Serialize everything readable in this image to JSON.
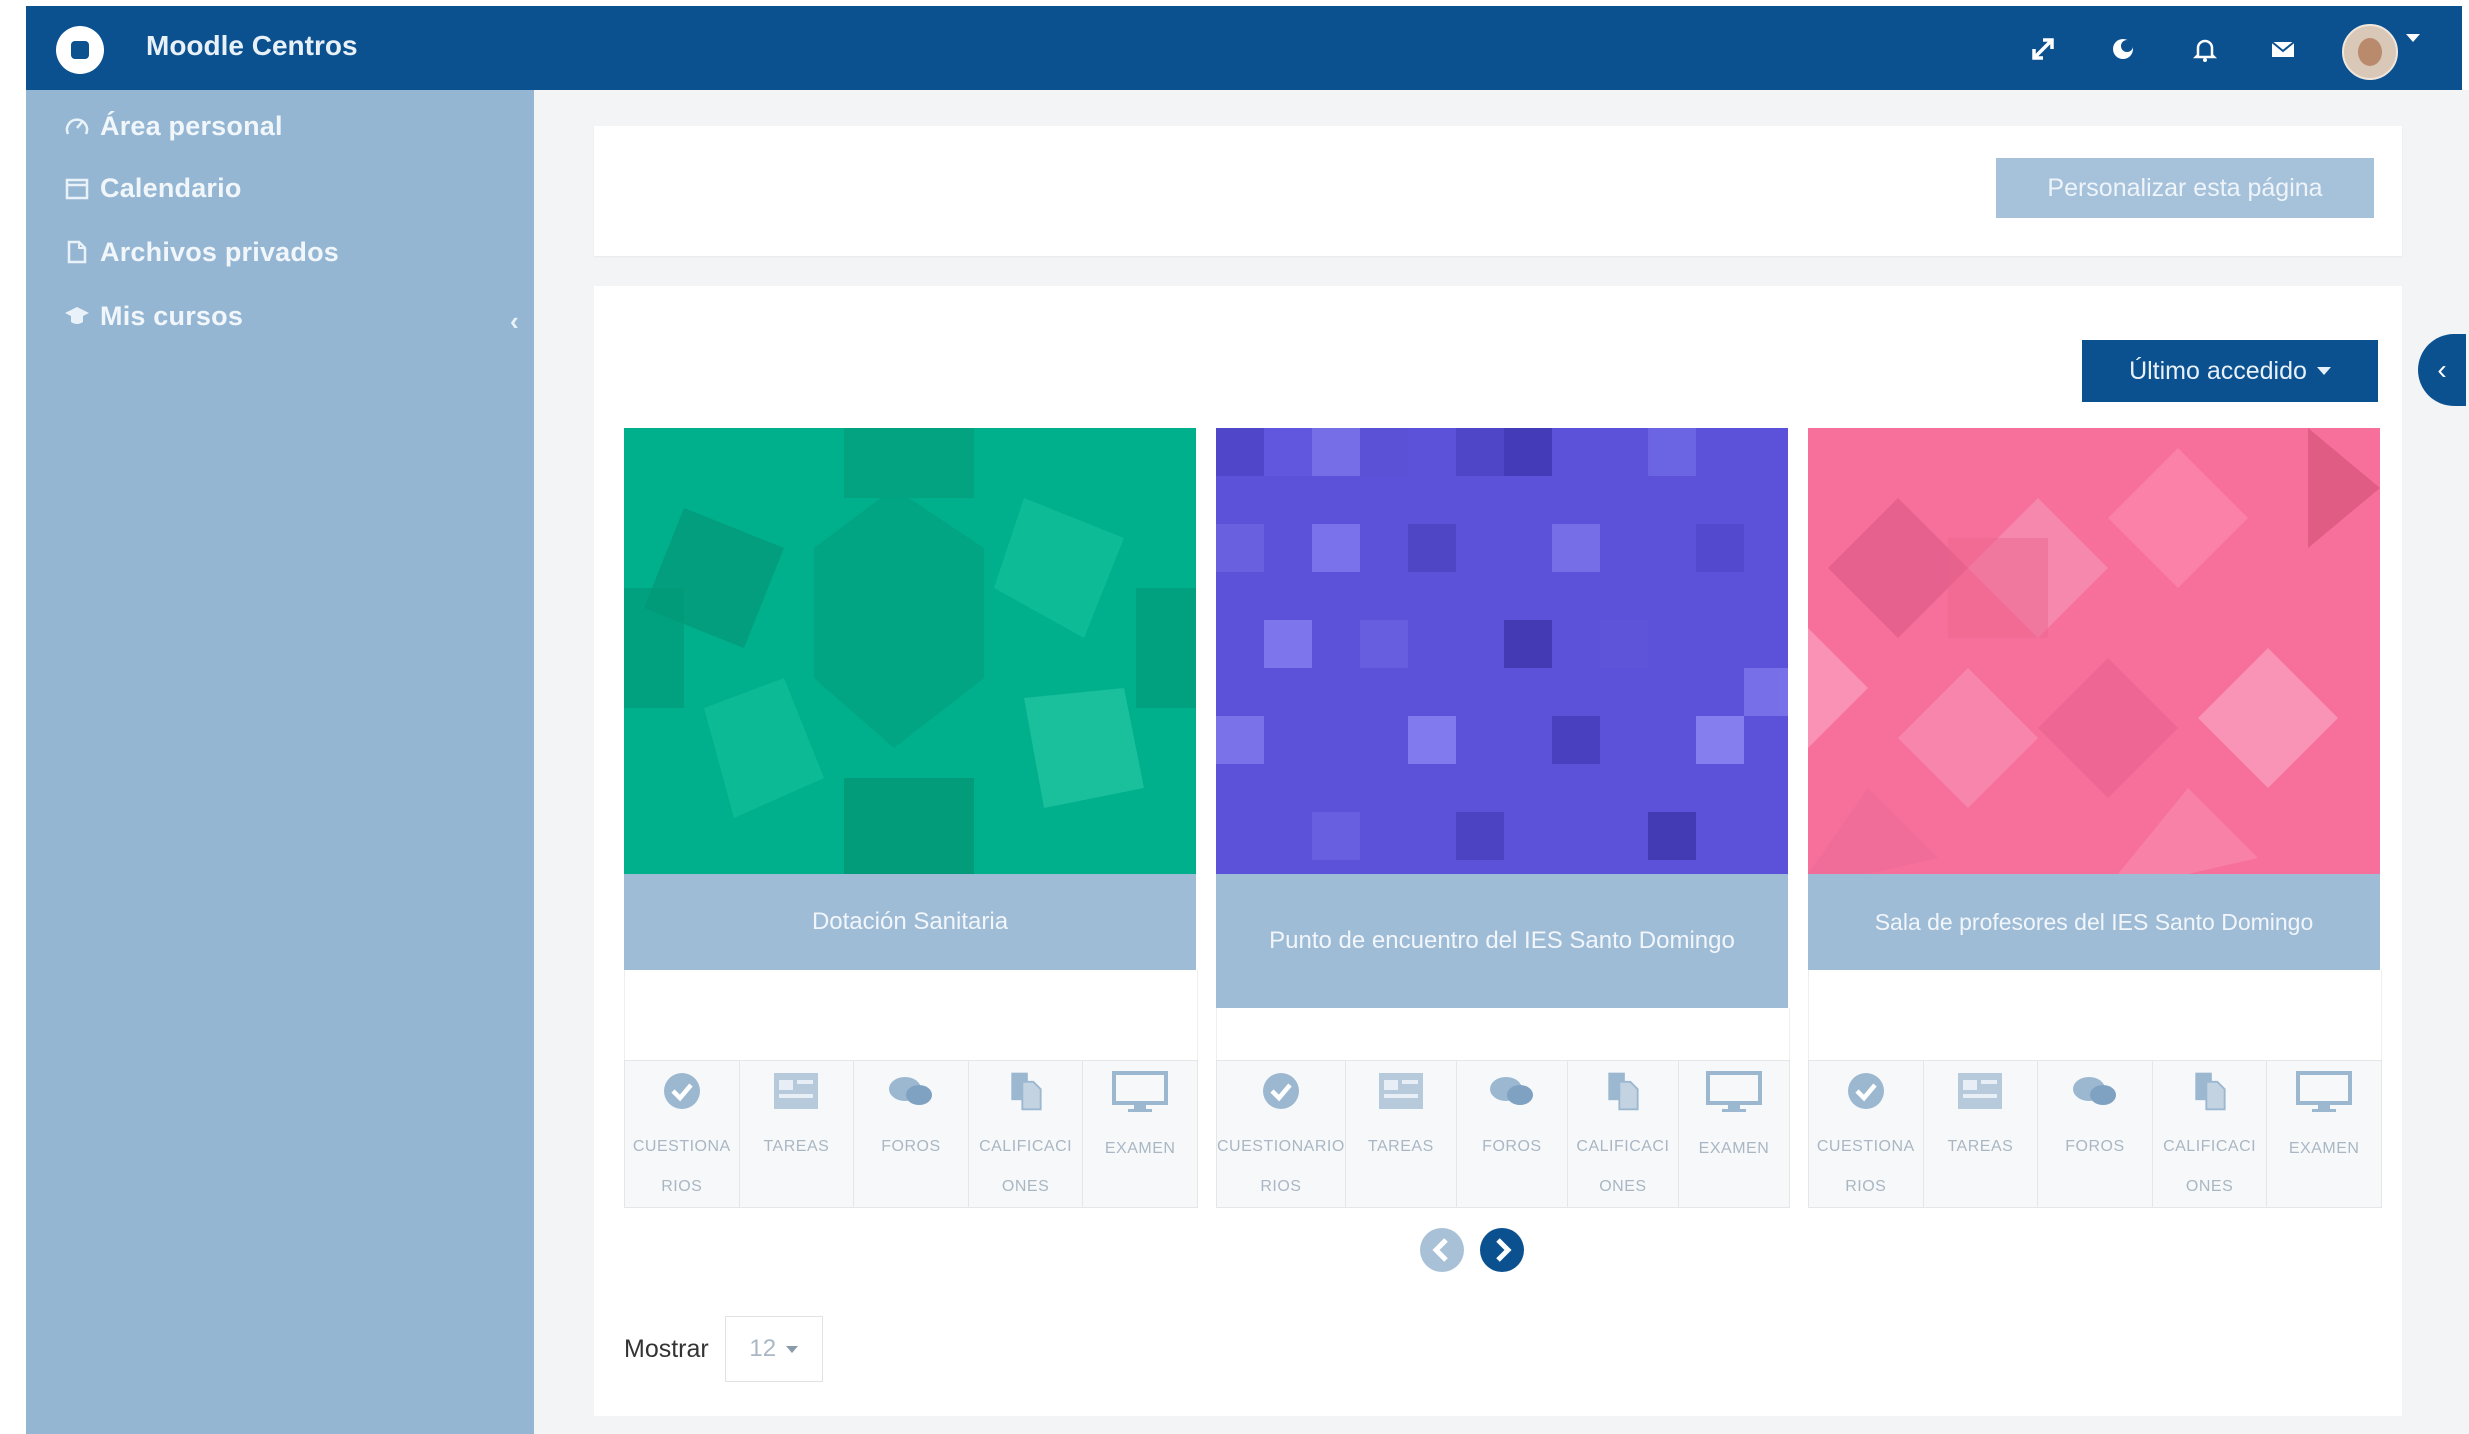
{
  "header": {
    "brand": "Moodle Centros",
    "icons": [
      "expand-icon",
      "theme-icon",
      "bell-icon",
      "envelope-icon",
      "avatar"
    ],
    "colors": {
      "bar": "#0b5190"
    }
  },
  "sidebar": {
    "items": [
      {
        "label": "Área personal",
        "icon": "dashboard-icon"
      },
      {
        "label": "Calendario",
        "icon": "calendar-icon"
      },
      {
        "label": "Archivos privados",
        "icon": "files-icon"
      },
      {
        "label": "Mis cursos",
        "icon": "graduation-cap-icon",
        "expandable": true
      }
    ],
    "colors": {
      "background": "#94b6d3"
    }
  },
  "main": {
    "customize_label": "Personalizar esta página",
    "sort_label": "Último accedido",
    "collapse_glyph": "‹",
    "courses": [
      {
        "title": "Dotación Sanitaria",
        "color": "#00b08c",
        "activities": [
          {
            "icon": "check-icon",
            "caption": "CUESTIONA|RIOS"
          },
          {
            "icon": "table-icon",
            "caption": "TAREAS"
          },
          {
            "icon": "forum-icon",
            "caption": "FOROS"
          },
          {
            "icon": "copy-icon",
            "caption": "CALIFICACI|ONES"
          },
          {
            "icon": "monitor-icon",
            "caption": "EXAMEN"
          }
        ]
      },
      {
        "title": "Punto de encuentro del IES Santo Domingo",
        "color": "#5b52d9",
        "activities": [
          {
            "icon": "check-icon",
            "caption": "CUESTIONARIO|RIOS"
          },
          {
            "icon": "table-icon",
            "caption": "TAREAS"
          },
          {
            "icon": "forum-icon",
            "caption": "FOROS"
          },
          {
            "icon": "copy-icon",
            "caption": "CALIFICACI|ONES"
          },
          {
            "icon": "monitor-icon",
            "caption": "EXAMEN"
          }
        ]
      },
      {
        "title": "Sala de profesores del IES Santo Domingo",
        "color": "#f76f9b",
        "activities": [
          {
            "icon": "check-icon",
            "caption": "CUESTIONA|RIOS"
          },
          {
            "icon": "table-icon",
            "caption": "TAREAS"
          },
          {
            "icon": "forum-icon",
            "caption": "FOROS"
          },
          {
            "icon": "copy-icon",
            "caption": "CALIFICACI|ONES"
          },
          {
            "icon": "monitor-icon",
            "caption": "EXAMEN"
          }
        ]
      }
    ],
    "show_label": "Mostrar",
    "show_value": "12"
  }
}
